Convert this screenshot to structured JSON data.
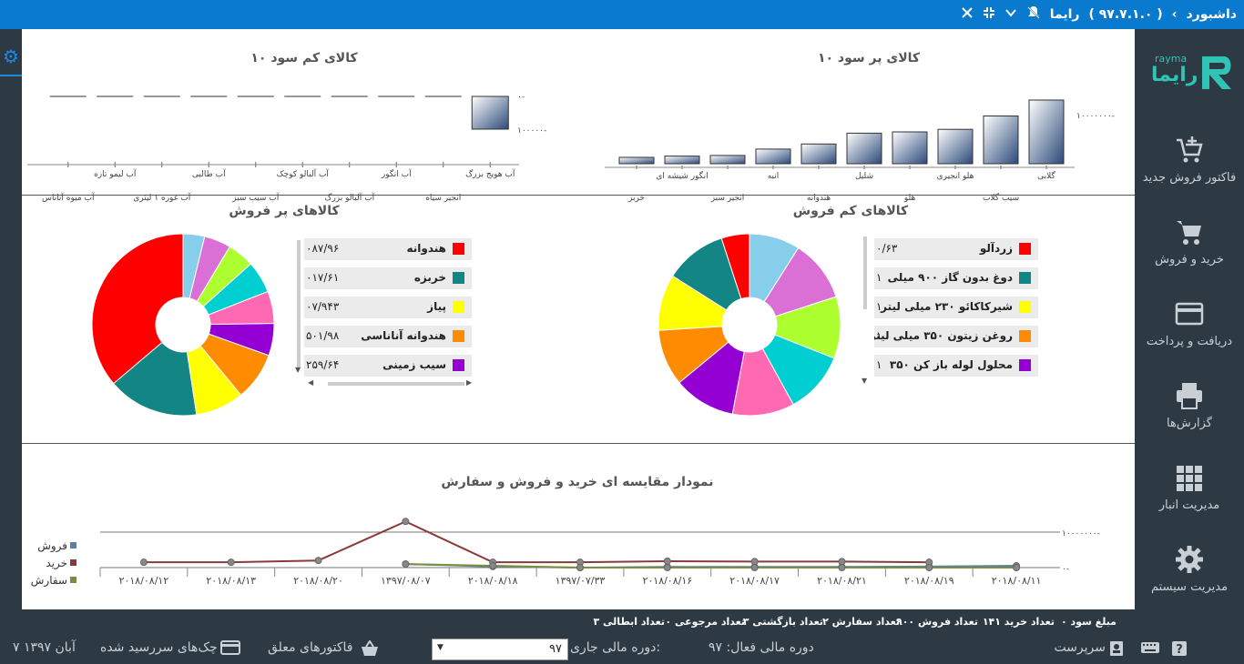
{
  "titlebar": {
    "page": "داشبورد",
    "app": "رایما",
    "version": "( ۹۷.۷.۱.۰ )",
    "accent": "#0a7acf"
  },
  "sidebar": {
    "logo_text": "رایما",
    "logo_small": "rayma",
    "items": [
      {
        "label": "فاکتور فروش جدید",
        "icon": "add-cart-icon"
      },
      {
        "label": "خرید و فروش",
        "icon": "cart-icon"
      },
      {
        "label": "دریافت و پرداخت",
        "icon": "credit-card-icon"
      },
      {
        "label": "گزارش‌ها",
        "icon": "printer-icon"
      },
      {
        "label": "مدیریت انبار",
        "icon": "grid-icon"
      },
      {
        "label": "مدیریت سیستم",
        "icon": "gear-icon"
      }
    ]
  },
  "charts": {
    "top_profit_title": "۱۰ کالای پر سود",
    "low_profit_title": "۱۰ کالای کم سود",
    "top_sales_title": "کالاهای پر فروش",
    "low_sales_title": "کالاهای کم فروش",
    "compare_title": "نمودار مقایسه ای خرید و فروش و سفارش"
  },
  "chart_data": [
    {
      "id": "top_profit",
      "type": "bar",
      "title": "۱۰ کالای پر سود",
      "categories": [
        "گلابی",
        "سیب گلاب",
        "هلو انجیری",
        "هلو",
        "شلیل",
        "هندوانه",
        "انبه",
        "انجیر سبز",
        "انگور شیشه ای",
        "خربز"
      ],
      "values": [
        10000000,
        7500000,
        5400000,
        5000000,
        4800000,
        3100000,
        2300000,
        1300000,
        1200000,
        1000000
      ],
      "y_tick": "۱۰۰۰۰۰۰۰-"
    },
    {
      "id": "low_profit",
      "type": "bar",
      "title": "۱۰ کالای کم سود",
      "categories": [
        "آب هویج بزرگ",
        "انجیر سیاه",
        "آب انگور",
        "آب آلبالو بزرگ",
        "آب آلبالو کوچک",
        "آب سیب سبز",
        "آب طالبی",
        "آب غوره ۱ لیتری",
        "آب لیمو تازه",
        "آب میوه آناناس"
      ],
      "values": [
        -100000,
        0,
        0,
        0,
        0,
        0,
        0,
        0,
        0,
        0
      ],
      "y_ticks": [
        "۰-",
        "۱۰۰۰۰۰-"
      ]
    },
    {
      "id": "top_sales",
      "type": "pie",
      "title": "کالاهای پر فروش",
      "labels": [
        "هندوانه",
        "خربزه",
        "پیاز",
        "هندوانه آناناسی",
        "سیب زمینی"
      ],
      "legend_values": [
        "۰۸۷/۹۶",
        "۰۱۷/۶۱",
        "۰۷/۹۴۳",
        "۵۰۱/۹۸",
        "۲۵۹/۶۴"
      ],
      "slice_values": [
        38,
        17,
        9,
        9,
        6,
        6,
        6,
        5,
        5,
        4
      ],
      "colors": [
        "#ff0000",
        "#138585",
        "#ffff00",
        "#ff8c00",
        "#9400d3",
        "#ff69b4",
        "#00ced1",
        "#adff2f",
        "#da70d6",
        "#87ceeb"
      ]
    },
    {
      "id": "low_sales",
      "type": "pie",
      "title": "کالاهای کم فروش",
      "labels": [
        "زردآلو",
        "دوغ بدون گاز ۹۰۰ میلی",
        "شیرکاکائو ۲۳۰ میلی لیتر",
        "روغن زیتون ۳۵۰ میلی لیتر",
        "محلول لوله باز کن ۳۵۰"
      ],
      "legend_values": [
        "۰/۶۳",
        "۱",
        "۱",
        "۱",
        "۱"
      ],
      "slice_values": [
        5,
        11,
        10,
        10,
        11,
        11,
        11,
        11,
        11,
        9
      ],
      "colors": [
        "#ff0000",
        "#138585",
        "#ffff00",
        "#ff8c00",
        "#9400d3",
        "#ff69b4",
        "#00ced1",
        "#adff2f",
        "#da70d6",
        "#87ceeb"
      ]
    },
    {
      "id": "compare",
      "type": "line",
      "title": "نمودار مقایسه ای خرید و فروش و سفارش",
      "categories": [
        "۲۰۱۸/۰۸/۱۲",
        "۲۰۱۸/۰۸/۱۳",
        "۲۰۱۸/۰۸/۲۰",
        "۱۳۹۷/۰۸/۰۷",
        "۲۰۱۸/۰۸/۱۸",
        "۱۳۹۷/۰۷/۳۳",
        "۲۰۱۸/۰۸/۱۶",
        "۲۰۱۸/۰۸/۱۷",
        "۲۰۱۸/۰۸/۲۱",
        "۲۰۱۸/۰۸/۱۹",
        "۲۰۱۸/۰۸/۱۱"
      ],
      "y_ticks": [
        "۱۰۰۰۰۰۰۰-",
        "۰-"
      ],
      "ylim": [
        0,
        10000000
      ],
      "series": [
        {
          "name": "فروش",
          "color": "#5a7fa8",
          "values": [
            null,
            null,
            null,
            1000000,
            300000,
            0,
            200000,
            200000,
            200000,
            300000,
            500000
          ]
        },
        {
          "name": "خرید",
          "color": "#8b3a3a",
          "values": [
            1500000,
            1500000,
            2000000,
            13000000,
            1500000,
            1500000,
            1800000,
            1700000,
            1700000,
            1500000,
            null
          ]
        },
        {
          "name": "سفارش",
          "color": "#7a8f3a",
          "values": [
            null,
            null,
            null,
            1000000,
            500000,
            0,
            0,
            0,
            0,
            0,
            0
          ]
        }
      ]
    }
  ],
  "stats": [
    "مبلغ سود ۰",
    "تعداد خرید ۱۴۱",
    "تعداد فروش ۹۰۰",
    "تعداد سفارش ۲",
    "تعداد بازگشتی ۳",
    "تعداد مرجوعی ۰",
    "تعداد ابطالی ۳"
  ],
  "footer": {
    "user": "سرپرست",
    "active_period": "دوره مالی فعال: ۹۷",
    "current_period_label": "دوره مالی جاری:",
    "current_period_value": "۹۷",
    "pending_invoices": "فاکتورهای معلق",
    "due_checks": "چک‌های سررسید شده",
    "date": "۷ آبان ۱۳۹۷"
  }
}
